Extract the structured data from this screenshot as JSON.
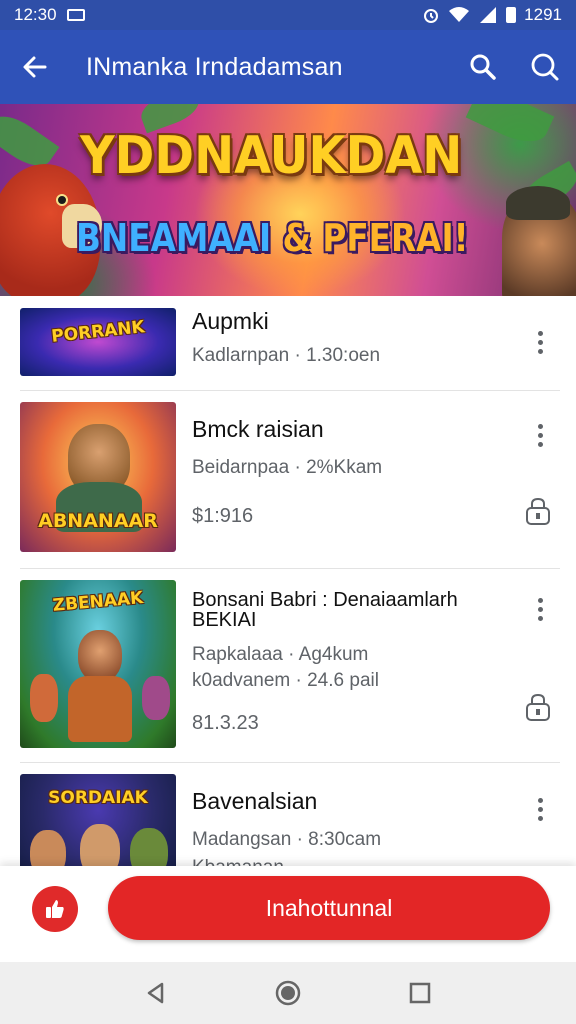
{
  "status_bar": {
    "time": "12:30",
    "right_time": "1291"
  },
  "app_bar": {
    "title": "INmanka Irndadamsan"
  },
  "hero": {
    "line1": "YDDNAUKDAN",
    "line2_part1": "BNEAMAAI",
    "line2_part2": "& PFERAI!"
  },
  "items": [
    {
      "title": "Aupmki",
      "meta": "Kadlarnpan · 1.30:oen",
      "thumb_text": "PORRANK"
    },
    {
      "title": "Bmck raisian",
      "meta": "Beidarnpaa · 2%Kkam",
      "price": "$1:916",
      "thumb_text": "ABNANAAR"
    },
    {
      "title": "Bonsani Babri : Denaiaamlarh",
      "title2": "BEKIAI",
      "meta": "Rapkalaaa · Ag4kum",
      "meta2": "k0advanem · 24.6 pail",
      "price": "81.3.23",
      "thumb_text": "ZBENAAK"
    },
    {
      "title": "Bavenalsian",
      "meta": "Madangsan · 8:30cam",
      "meta2": "Kbamanan",
      "thumb_text": "SORDAIAK"
    }
  ],
  "bottom": {
    "cta_label": "Inahottunnal"
  },
  "colors": {
    "app_bar": "#2f52b8",
    "cta": "#e32626"
  }
}
